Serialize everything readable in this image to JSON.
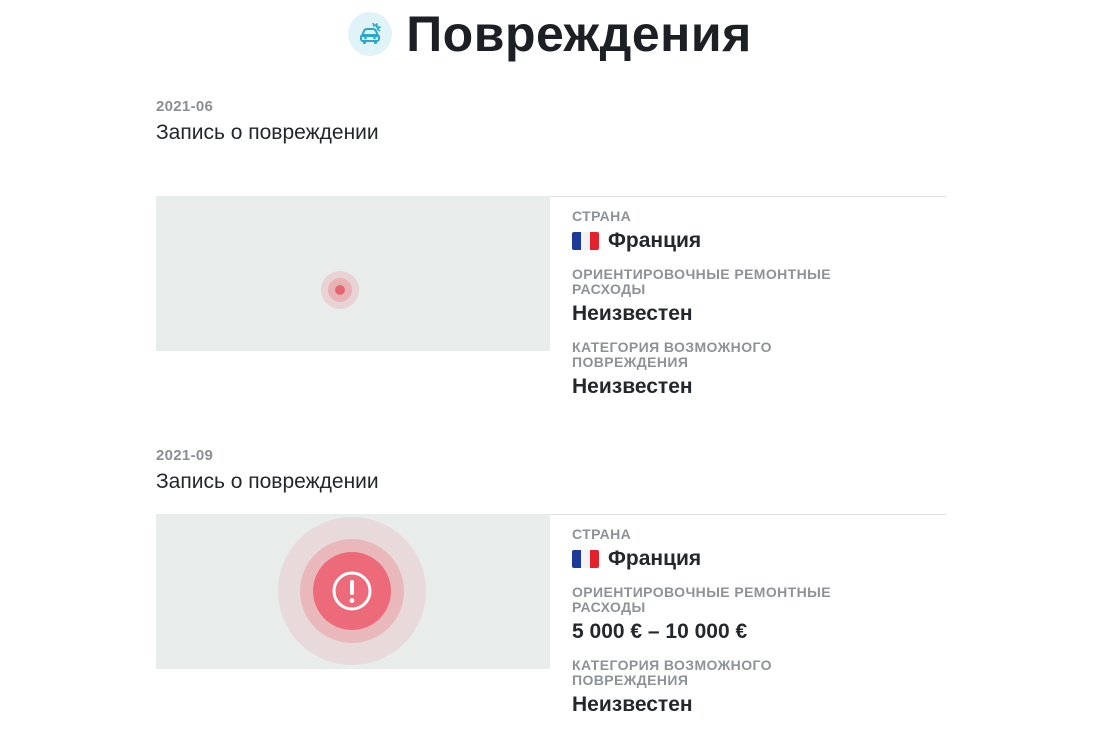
{
  "header": {
    "title": "Повреждения",
    "icon": "car-damage-icon",
    "icon_color": "#2aa7c9"
  },
  "records": [
    {
      "date": "2021-06",
      "title": "Запись о повреждении",
      "severity_marker": "small-dot",
      "fields": {
        "country_label": "Страна",
        "country_value": "Франция",
        "country_flag": "france-flag-icon",
        "cost_label": "Ориентировочные ремонтные расходы",
        "cost_value": "Неизвестен",
        "category_label": "Категория возможного повреждения",
        "category_value": "Неизвестен"
      }
    },
    {
      "date": "2021-09",
      "title": "Запись о повреждении",
      "severity_marker": "alert-icon",
      "fields": {
        "country_label": "Страна",
        "country_value": "Франция",
        "country_flag": "france-flag-icon",
        "cost_label": "Ориентировочные ремонтные расходы",
        "cost_value": "5 000 € – 10 000 €",
        "category_label": "Категория возможного повреждения",
        "category_value": "Неизвестен"
      }
    }
  ],
  "colors": {
    "marker_red": "#ec6a79",
    "map_background": "#e8ecea",
    "label_gray": "#8e9297"
  }
}
